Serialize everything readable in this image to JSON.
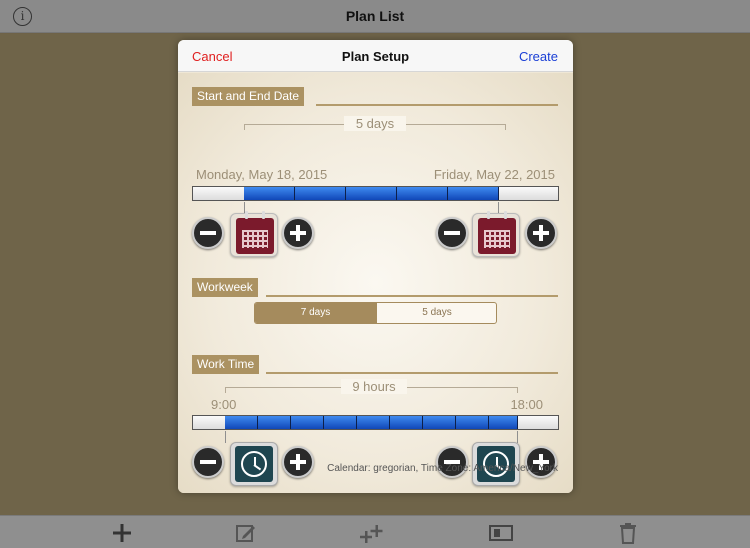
{
  "topbar": {
    "title": "Plan List",
    "info_icon": "info-icon"
  },
  "toolbar": {
    "icons": [
      "plus-icon",
      "edit-icon",
      "add-multiple-icon",
      "card-icon",
      "trash-icon"
    ]
  },
  "modal": {
    "title": "Plan Setup",
    "cancel_label": "Cancel",
    "create_label": "Create",
    "date_section": {
      "label": "Start and End Date",
      "span": "5 days",
      "start": "Monday, May 18, 2015",
      "end": "Friday, May 22, 2015",
      "icon": "calendar-icon"
    },
    "workweek_section": {
      "label": "Workweek",
      "options": [
        "7 days",
        "5 days"
      ],
      "selected": "7 days"
    },
    "worktime_section": {
      "label": "Work Time",
      "span": "9 hours",
      "start": "9:00",
      "end": "18:00",
      "icon": "clock-icon"
    },
    "footer": "Calendar: gregorian, Time Zone: America/New_York"
  },
  "colors": {
    "accent": "#ab9262",
    "cancel": "#e02020",
    "create": "#1a3fd6",
    "bar": "#1a5fd6"
  }
}
